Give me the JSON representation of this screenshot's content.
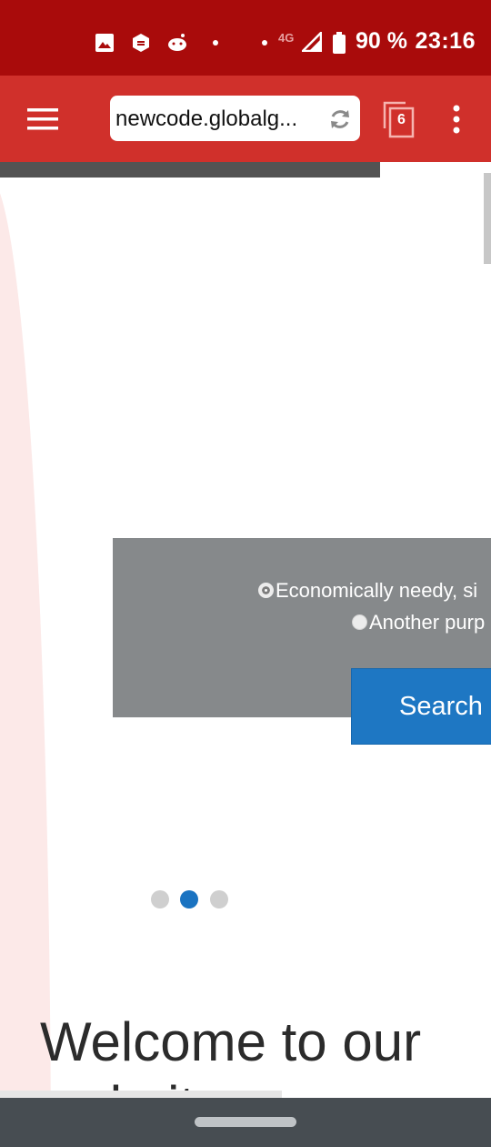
{
  "status_bar": {
    "time": "23:16",
    "battery_percent": "90 %",
    "network_type": "4G",
    "notification_icons": [
      "image-icon",
      "shield-hexagon-icon",
      "reddit-icon",
      "dot-icon"
    ]
  },
  "toolbar": {
    "url": "newcode.globalg...",
    "tab_count": "6"
  },
  "page": {
    "radio_options": [
      {
        "label": "Economically needy, si",
        "checked": true
      },
      {
        "label": "Another purp",
        "checked": false
      }
    ],
    "search_label": "Search",
    "carousel": {
      "count": 3,
      "active_index": 1
    },
    "heading": "Welcome to our website"
  },
  "colors": {
    "status_bar": "#a90b0b",
    "toolbar": "#d0302b",
    "search_button": "#1e77c3",
    "active_dot": "#1a73c1"
  }
}
